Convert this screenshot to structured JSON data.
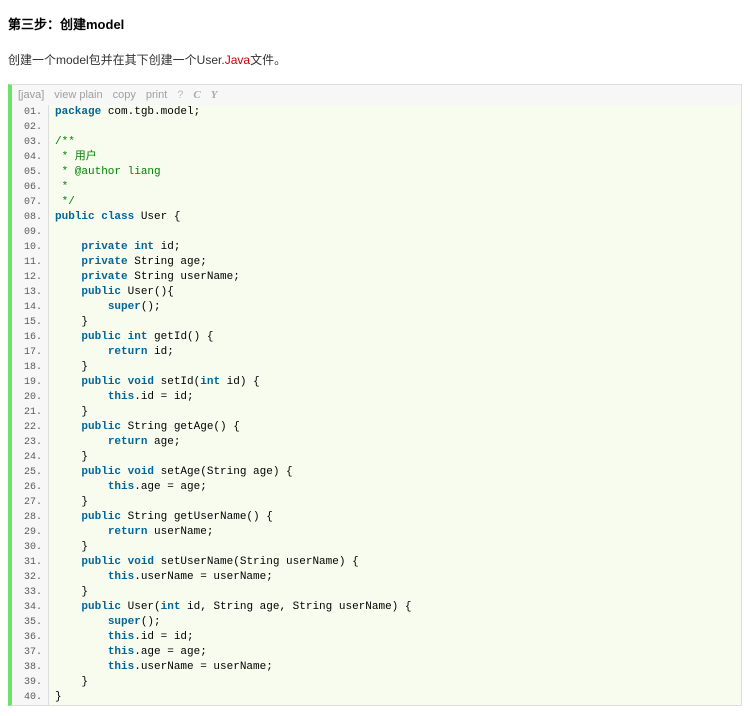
{
  "heading": "第三步：创建model",
  "desc_prefix": "创建一个model包并在其下创建一个User.",
  "desc_red": "Java",
  "desc_suffix": "文件。",
  "toolbar": {
    "lang": "[java]",
    "view": "view plain",
    "copy": "copy",
    "print": "print",
    "qm": "?"
  },
  "code": [
    [
      [
        "kw",
        "package"
      ],
      [
        "",
        " com.tgb.model;"
      ]
    ],
    [],
    [
      [
        "cmt",
        "/**"
      ]
    ],
    [
      [
        "cmt",
        " * 用户"
      ]
    ],
    [
      [
        "cmt",
        " * @author liang"
      ]
    ],
    [
      [
        "cmt",
        " *"
      ]
    ],
    [
      [
        "cmt",
        " */"
      ]
    ],
    [
      [
        "kw",
        "public"
      ],
      [
        "",
        " "
      ],
      [
        "kw",
        "class"
      ],
      [
        "",
        " User {"
      ]
    ],
    [],
    [
      [
        "",
        "    "
      ],
      [
        "kw",
        "private"
      ],
      [
        "",
        " "
      ],
      [
        "kw",
        "int"
      ],
      [
        "",
        " id;"
      ]
    ],
    [
      [
        "",
        "    "
      ],
      [
        "kw",
        "private"
      ],
      [
        "",
        " String age;"
      ]
    ],
    [
      [
        "",
        "    "
      ],
      [
        "kw",
        "private"
      ],
      [
        "",
        " String userName;"
      ]
    ],
    [
      [
        "",
        "    "
      ],
      [
        "kw",
        "public"
      ],
      [
        "",
        " User(){"
      ]
    ],
    [
      [
        "",
        "        "
      ],
      [
        "kw",
        "super"
      ],
      [
        "",
        "();"
      ]
    ],
    [
      [
        "",
        "    }"
      ]
    ],
    [
      [
        "",
        "    "
      ],
      [
        "kw",
        "public"
      ],
      [
        "",
        " "
      ],
      [
        "kw",
        "int"
      ],
      [
        "",
        " getId() {"
      ]
    ],
    [
      [
        "",
        "        "
      ],
      [
        "kw",
        "return"
      ],
      [
        "",
        " id;"
      ]
    ],
    [
      [
        "",
        "    }"
      ]
    ],
    [
      [
        "",
        "    "
      ],
      [
        "kw",
        "public"
      ],
      [
        "",
        " "
      ],
      [
        "kw",
        "void"
      ],
      [
        "",
        " setId("
      ],
      [
        "kw",
        "int"
      ],
      [
        "",
        " id) {"
      ]
    ],
    [
      [
        "",
        "        "
      ],
      [
        "kw",
        "this"
      ],
      [
        "",
        ".id = id;"
      ]
    ],
    [
      [
        "",
        "    }"
      ]
    ],
    [
      [
        "",
        "    "
      ],
      [
        "kw",
        "public"
      ],
      [
        "",
        " String getAge() {"
      ]
    ],
    [
      [
        "",
        "        "
      ],
      [
        "kw",
        "return"
      ],
      [
        "",
        " age;"
      ]
    ],
    [
      [
        "",
        "    }"
      ]
    ],
    [
      [
        "",
        "    "
      ],
      [
        "kw",
        "public"
      ],
      [
        "",
        " "
      ],
      [
        "kw",
        "void"
      ],
      [
        "",
        " setAge(String age) {"
      ]
    ],
    [
      [
        "",
        "        "
      ],
      [
        "kw",
        "this"
      ],
      [
        "",
        ".age = age;"
      ]
    ],
    [
      [
        "",
        "    }"
      ]
    ],
    [
      [
        "",
        "    "
      ],
      [
        "kw",
        "public"
      ],
      [
        "",
        " String getUserName() {"
      ]
    ],
    [
      [
        "",
        "        "
      ],
      [
        "kw",
        "return"
      ],
      [
        "",
        " userName;"
      ]
    ],
    [
      [
        "",
        "    }"
      ]
    ],
    [
      [
        "",
        "    "
      ],
      [
        "kw",
        "public"
      ],
      [
        "",
        " "
      ],
      [
        "kw",
        "void"
      ],
      [
        "",
        " setUserName(String userName) {"
      ]
    ],
    [
      [
        "",
        "        "
      ],
      [
        "kw",
        "this"
      ],
      [
        "",
        ".userName = userName;"
      ]
    ],
    [
      [
        "",
        "    }"
      ]
    ],
    [
      [
        "",
        "    "
      ],
      [
        "kw",
        "public"
      ],
      [
        "",
        " User("
      ],
      [
        "kw",
        "int"
      ],
      [
        "",
        " id, String age, String userName) {"
      ]
    ],
    [
      [
        "",
        "        "
      ],
      [
        "kw",
        "super"
      ],
      [
        "",
        "();"
      ]
    ],
    [
      [
        "",
        "        "
      ],
      [
        "kw",
        "this"
      ],
      [
        "",
        ".id = id;"
      ]
    ],
    [
      [
        "",
        "        "
      ],
      [
        "kw",
        "this"
      ],
      [
        "",
        ".age = age;"
      ]
    ],
    [
      [
        "",
        "        "
      ],
      [
        "kw",
        "this"
      ],
      [
        "",
        ".userName = userName;"
      ]
    ],
    [
      [
        "",
        "    }"
      ]
    ],
    [
      [
        "",
        "}"
      ]
    ]
  ]
}
